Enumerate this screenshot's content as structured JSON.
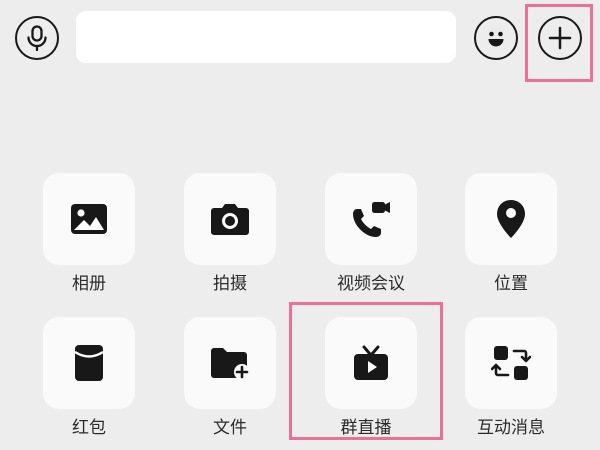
{
  "toolbar": {
    "mic_icon": "microphone-icon",
    "emoji_icon": "emoji-icon",
    "plus_icon": "plus-icon",
    "input_value": ""
  },
  "panel": {
    "items": [
      {
        "label": "相册",
        "icon": "photo-icon"
      },
      {
        "label": "拍摄",
        "icon": "camera-icon"
      },
      {
        "label": "视频会议",
        "icon": "video-call-icon"
      },
      {
        "label": "位置",
        "icon": "location-pin-icon"
      },
      {
        "label": "红包",
        "icon": "red-packet-icon"
      },
      {
        "label": "文件",
        "icon": "folder-add-icon"
      },
      {
        "label": "群直播",
        "icon": "tv-live-icon"
      },
      {
        "label": "互动消息",
        "icon": "interactive-message-icon"
      }
    ]
  },
  "highlight_color": "#ec6f95"
}
